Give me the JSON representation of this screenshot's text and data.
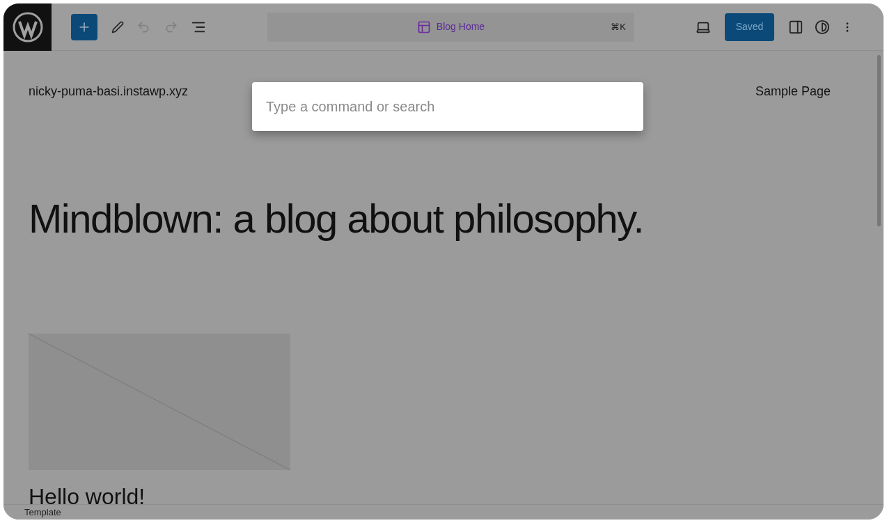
{
  "toolbar": {
    "document_title": "Blog Home",
    "shortcut": "⌘K",
    "save_button": "Saved"
  },
  "command_palette": {
    "placeholder": "Type a command or search"
  },
  "site": {
    "title": "nicky-puma-basi.instawp.xyz",
    "nav": [
      "Sample Page"
    ]
  },
  "content": {
    "heading": "Mindblown: a blog about philosophy.",
    "post_title": "Hello world!"
  },
  "footer": {
    "breadcrumb": "Template"
  }
}
